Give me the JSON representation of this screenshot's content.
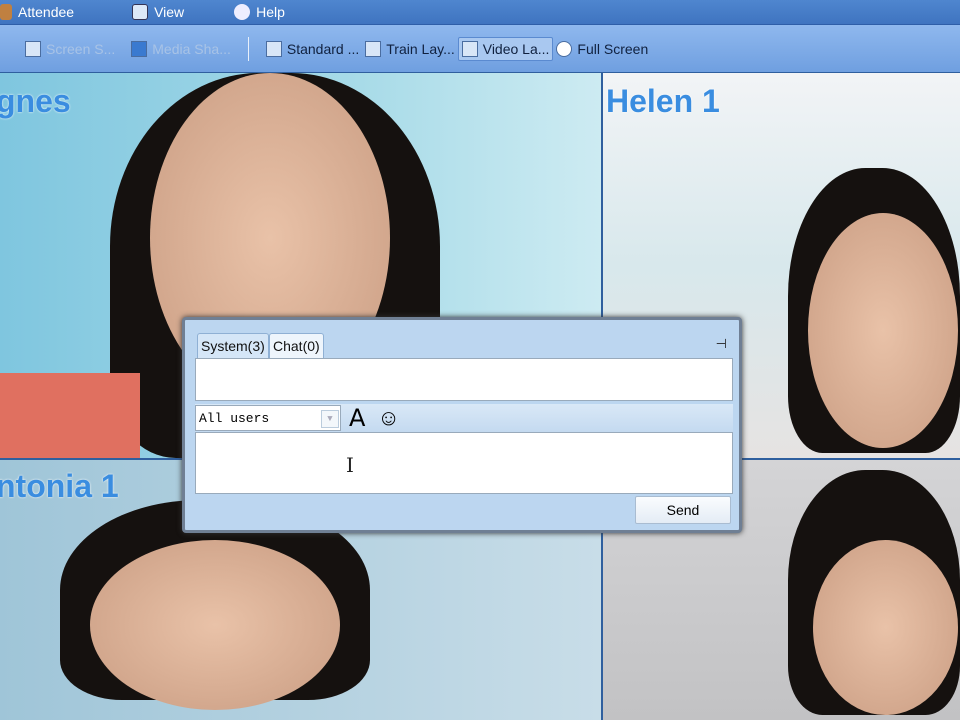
{
  "menubar": {
    "items": [
      {
        "label": "Attendee",
        "icon": "user-icon"
      },
      {
        "label": "View",
        "icon": "view-icon"
      },
      {
        "label": "Help",
        "icon": "help-icon"
      }
    ]
  },
  "toolbar": {
    "items": [
      {
        "label": "Screen S...",
        "state": "disabled"
      },
      {
        "label": "Media Sha...",
        "state": "disabled"
      },
      {
        "label": "Standard ...",
        "state": "normal"
      },
      {
        "label": "Train Lay...",
        "state": "normal"
      },
      {
        "label": "Video La...",
        "state": "active"
      },
      {
        "label": "Full Screen",
        "state": "normal"
      }
    ]
  },
  "videos": [
    {
      "name": "gnes"
    },
    {
      "name": "Helen 1"
    },
    {
      "name": "ntonia 1"
    },
    {
      "name": ""
    }
  ],
  "chat": {
    "tabs": [
      "System(3)",
      "Chat(0)"
    ],
    "active_tab": "Chat(0)",
    "recipient": "All users",
    "send_label": "Send",
    "message": ""
  }
}
